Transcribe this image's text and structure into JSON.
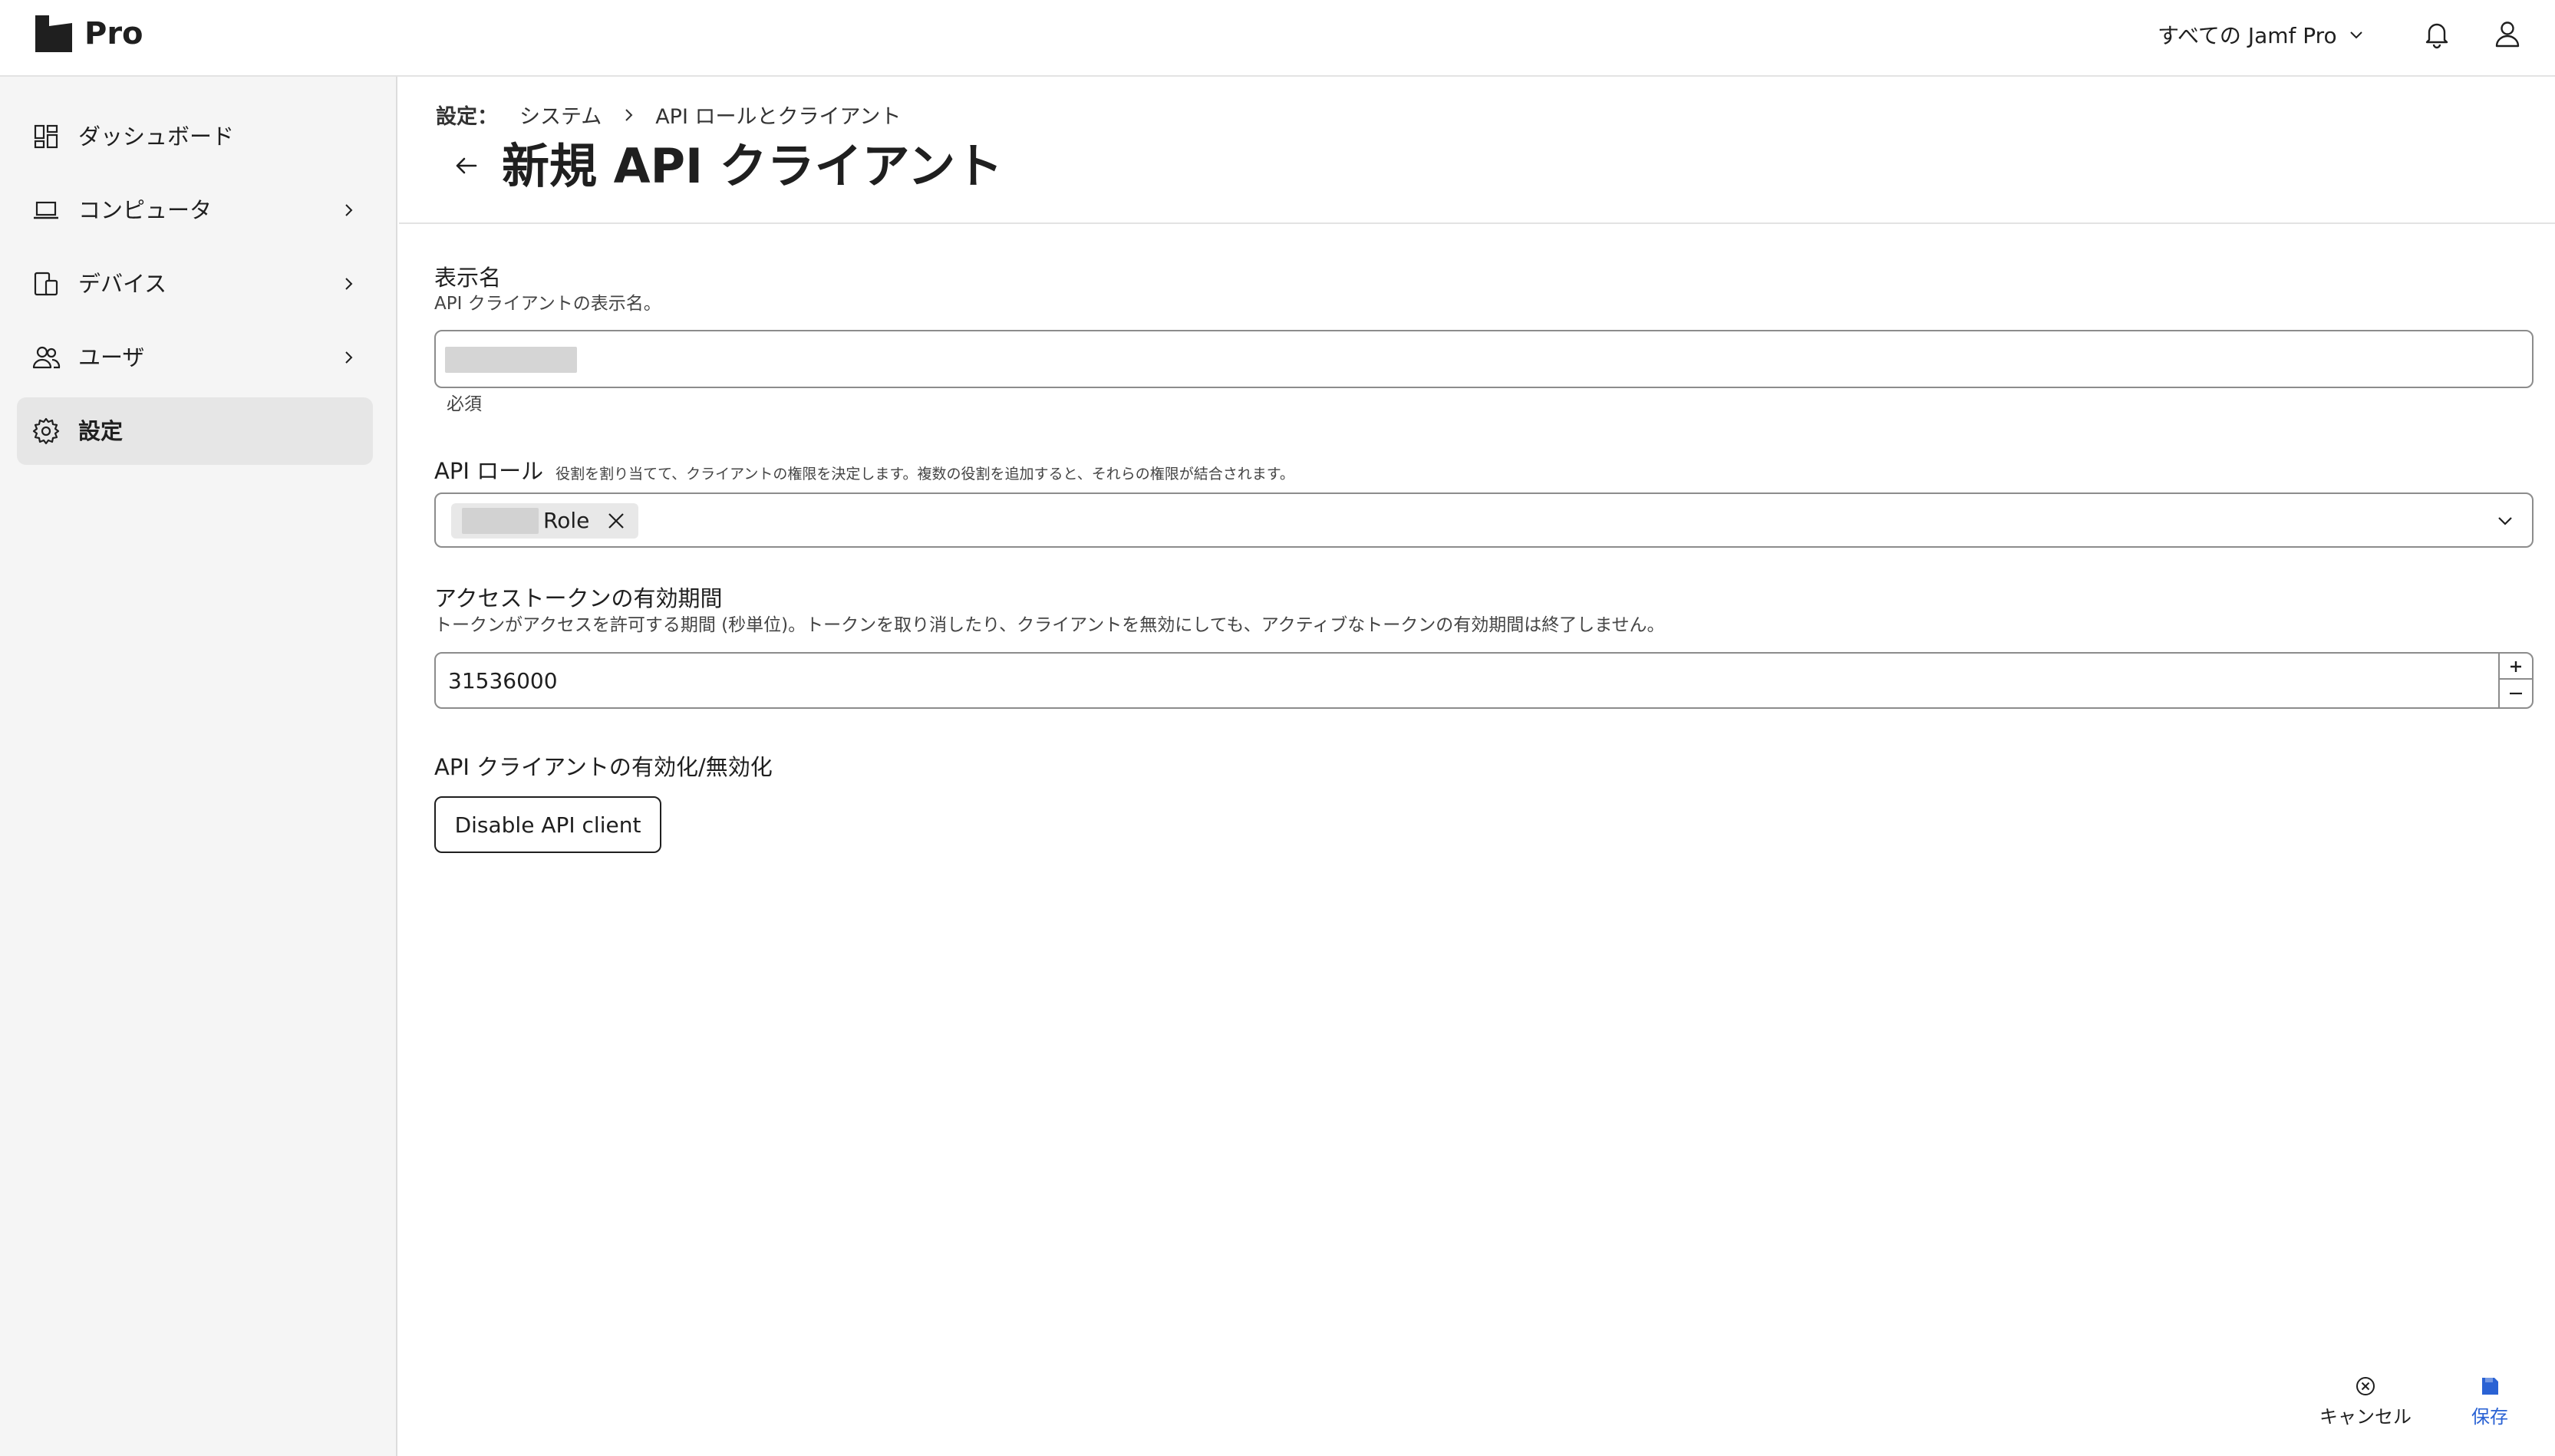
{
  "app": {
    "logo_text": "Pro",
    "scope_label": "すべての Jamf Pro"
  },
  "sidebar": {
    "items": [
      {
        "label": "ダッシュボード",
        "icon": "dashboard-icon"
      },
      {
        "label": "コンピュータ",
        "icon": "laptop-icon"
      },
      {
        "label": "デバイス",
        "icon": "devices-icon"
      },
      {
        "label": "ユーザ",
        "icon": "users-icon"
      },
      {
        "label": "設定",
        "icon": "gear-icon",
        "active": true
      }
    ]
  },
  "breadcrumb": {
    "root": "設定：",
    "items": [
      "システム",
      "API ロールとクライアント"
    ]
  },
  "page": {
    "title": "新規 API クライアント"
  },
  "form": {
    "display_name": {
      "label": "表示名",
      "description": "API クライアントの表示名。",
      "helper": "必須"
    },
    "api_roles": {
      "label": "API ロール",
      "description": "役割を割り当てて、クライアントの権限を決定します。複数の役割を追加すると、それらの権限が結合されます。",
      "chip_label": "Role"
    },
    "token_lifetime": {
      "label": "アクセストークンの有効期間",
      "description": "トークンがアクセスを許可する期間 (秒単位)。トークンを取り消したり、クライアントを無効にしても、アクティブなトークンの有効期間は終了しません。",
      "value": "31536000"
    },
    "enable_disable": {
      "label": "API クライアントの有効化/無効化",
      "button_label": "Disable API client"
    }
  },
  "footer": {
    "cancel_label": "キャンセル",
    "save_label": "保存"
  },
  "colors": {
    "accent": "#2a62d4",
    "sidebar_bg": "#f5f5f5",
    "active_item_bg": "#e6e6e6"
  }
}
